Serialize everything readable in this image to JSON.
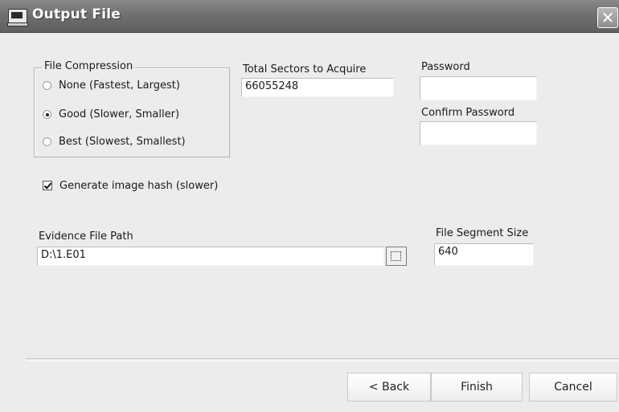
{
  "window": {
    "title": "Output File",
    "close_glyph": "✕",
    "app_icon": "computer-icon"
  },
  "compression": {
    "legend": "File Compression",
    "options": [
      {
        "label": "None (Fastest, Largest)",
        "selected": false
      },
      {
        "label": "Good (Slower, Smaller)",
        "selected": true
      },
      {
        "label": "Best (Slowest, Smallest)",
        "selected": false
      }
    ]
  },
  "sectors": {
    "label": "Total Sectors to Acquire",
    "value": "66055248"
  },
  "password": {
    "label": "Password",
    "value": ""
  },
  "confirm_password": {
    "label": "Confirm Password",
    "value": ""
  },
  "hash": {
    "label": "Generate image hash (slower)",
    "checked": true
  },
  "evidence": {
    "label": "Evidence File Path",
    "value": "D:\\1.E01"
  },
  "segment": {
    "label": "File Segment Size",
    "value": "640"
  },
  "buttons": {
    "back": "< Back",
    "finish": "Finish",
    "cancel": "Cancel"
  }
}
